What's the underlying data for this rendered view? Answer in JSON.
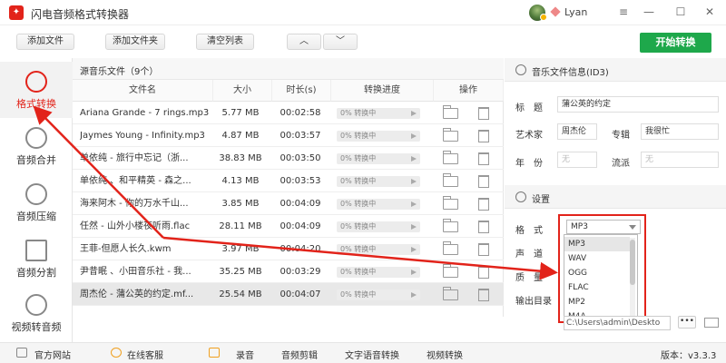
{
  "app": {
    "logo": "✦",
    "title": "闪电音频格式转换器",
    "user": "Lyan"
  },
  "toolbar": {
    "add_file": "添加文件",
    "add_folder": "添加文件夹",
    "clear": "清空列表",
    "up": "︿",
    "down": "﹀",
    "start": "开始转换"
  },
  "sidebar": [
    {
      "label": "格式转换",
      "icon": "convert-icon",
      "active": true
    },
    {
      "label": "音频合并",
      "icon": "merge-icon"
    },
    {
      "label": "音频压缩",
      "icon": "compress-icon"
    },
    {
      "label": "音频分割",
      "icon": "split-icon"
    },
    {
      "label": "视频转音频",
      "icon": "video-to-audio-icon"
    }
  ],
  "filelist": {
    "title": "源音乐文件（9个）",
    "columns": [
      "文件名",
      "大小",
      "时长(s)",
      "转换进度",
      "操作"
    ],
    "progress_text": "0% 转换中",
    "rows": [
      {
        "name": "Ariana Grande - 7 rings.mp3",
        "size": "5.77 MB",
        "duration": "00:02:58"
      },
      {
        "name": "Jaymes Young - Infinity.mp3",
        "size": "4.87 MB",
        "duration": "00:03:57"
      },
      {
        "name": "单依纯 - 旅行中忘记（浙...",
        "size": "38.83 MB",
        "duration": "00:03:50"
      },
      {
        "name": "单依纯 、和平精英 - 森之...",
        "size": "4.13 MB",
        "duration": "00:03:53"
      },
      {
        "name": "海来阿木 - 你的万水千山...",
        "size": "3.85 MB",
        "duration": "00:04:09"
      },
      {
        "name": "任然 - 山外小楼夜听雨.flac",
        "size": "28.11 MB",
        "duration": "00:04:09"
      },
      {
        "name": "王菲-但愿人长久.kwm",
        "size": "3.97 MB",
        "duration": "00:04:20"
      },
      {
        "name": "尹昔眠 、小田音乐社 - 我...",
        "size": "35.25 MB",
        "duration": "00:03:29"
      },
      {
        "name": "周杰伦 - 蒲公英的约定.mf...",
        "size": "25.54 MB",
        "duration": "00:04:07"
      }
    ]
  },
  "id3": {
    "title": "音乐文件信息(ID3)",
    "title_label": "标　题",
    "title_value": "蒲公英的约定",
    "artist_label": "艺术家",
    "artist_value": "周杰伦",
    "album_label": "专辑",
    "album_value": "我很忙",
    "year_label": "年　份",
    "year_value": "无",
    "genre_label": "流派",
    "genre_value": "无"
  },
  "settings": {
    "title": "设置",
    "format_label": "格　式",
    "format_value": "MP3",
    "channel_label": "声　道",
    "quality_label": "质　量",
    "options": [
      "MP3",
      "WAV",
      "OGG",
      "FLAC",
      "MP2",
      "M4A"
    ],
    "output_label": "输出目录",
    "output_value": "C:\\Users\\admin\\Deskto",
    "more": "•••"
  },
  "footer": {
    "website": "官方网站",
    "service": "在线客服",
    "record": "录音",
    "edit": "音频剪辑",
    "tts": "文字语音转换",
    "video": "视频转换",
    "version": "版本：v3.3.3"
  },
  "colors": {
    "accent": "#e2231a",
    "start": "#1ea84b"
  }
}
